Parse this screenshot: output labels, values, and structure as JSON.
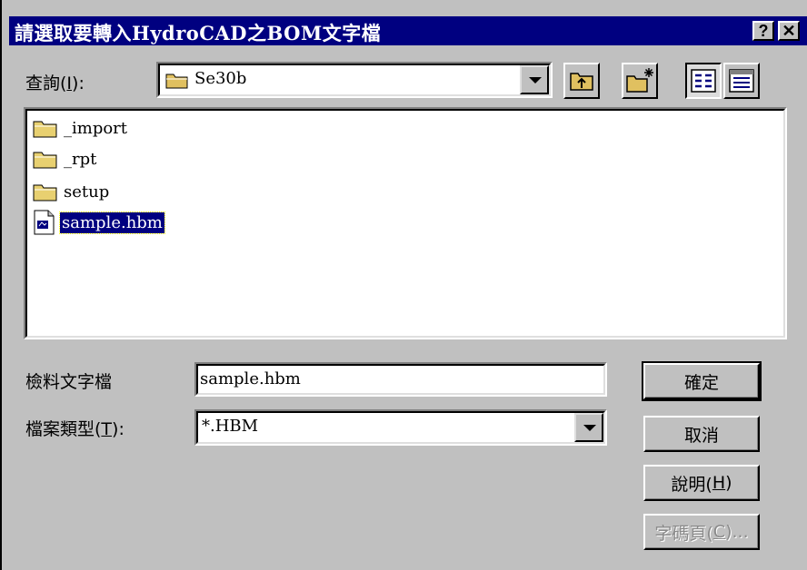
{
  "dialog": {
    "title": "請選取要轉入HydroCAD之BOM文字檔",
    "help_caption": "?",
    "close_caption": "✕"
  },
  "lookin": {
    "label_prefix": "查詢(",
    "label_key": "I",
    "label_suffix": "):",
    "value": "Se30b"
  },
  "files": [
    {
      "name": "_import",
      "type": "folder"
    },
    {
      "name": "_rpt",
      "type": "folder"
    },
    {
      "name": "setup",
      "type": "folder"
    },
    {
      "name": "sample.hbm",
      "type": "file",
      "selected": true
    }
  ],
  "filename": {
    "label": "檢料文字檔",
    "value": "sample.hbm"
  },
  "filetype": {
    "label_prefix": "檔案類型(",
    "label_key": "T",
    "label_suffix": "):",
    "value": "*.HBM"
  },
  "buttons": {
    "ok": "確定",
    "cancel": "取消",
    "help_prefix": "說明(",
    "help_key": "H",
    "help_suffix": ")",
    "codepage_prefix": "字碼頁(",
    "codepage_key": "C",
    "codepage_suffix": ")..."
  },
  "icons": {
    "toolbar": [
      "up-folder-icon",
      "new-folder-icon",
      "list-view-icon",
      "details-view-icon"
    ]
  }
}
